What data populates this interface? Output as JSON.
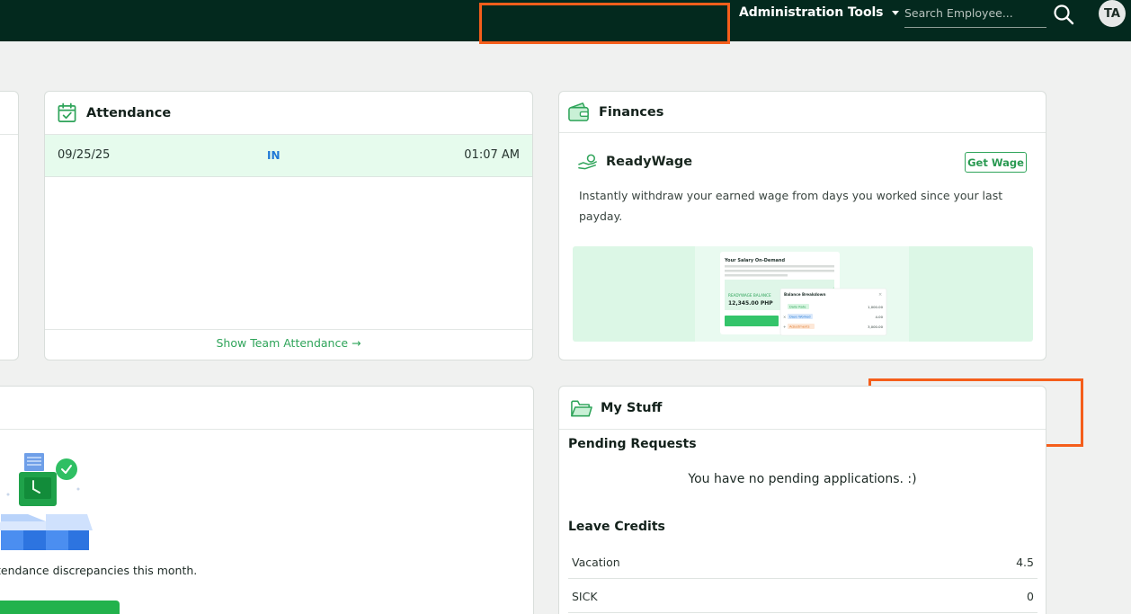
{
  "topbar": {
    "admin_tools_label": "Administration Tools",
    "search_placeholder": "Search Employee...",
    "avatar_initials": "TA"
  },
  "attendance": {
    "title": "Attendance",
    "rows": [
      {
        "date": "09/25/25",
        "status": "IN",
        "time": "01:07 AM"
      }
    ],
    "footer_link": "Show Team Attendance →"
  },
  "finances": {
    "title": "Finances",
    "readywage": {
      "title": "ReadyWage",
      "button": "Get Wage",
      "description": "Instantly withdraw your earned wage from days you worked since your last payday."
    },
    "promo": {
      "heading": "Your Salary On-Demand",
      "balance_label": "READYWAGE BALANCE",
      "balance_value": "12,345.00 PHP",
      "breakdown_title": "Balance Breakdown",
      "breakdown": [
        {
          "label": "Daily Rate",
          "value": "1,000.00"
        },
        {
          "label": "Days Worked",
          "value": "4.00"
        },
        {
          "label": "Adjustments",
          "value": "3,000.00"
        }
      ]
    }
  },
  "discrepancies": {
    "text": "tendance discrepancies this month."
  },
  "my_stuff": {
    "title": "My Stuff",
    "pending_title": "Pending Requests",
    "pending_empty": "You have no pending applications. :)",
    "leave_title": "Leave Credits",
    "leave_credits": [
      {
        "label": "Vacation",
        "value": "4.5"
      },
      {
        "label": "SICK",
        "value": "0"
      }
    ]
  },
  "colors": {
    "topbar_bg": "#03291e",
    "accent_green": "#2fa45a",
    "status_blue": "#1e78d6",
    "highlight_orange": "#f55e1b"
  }
}
